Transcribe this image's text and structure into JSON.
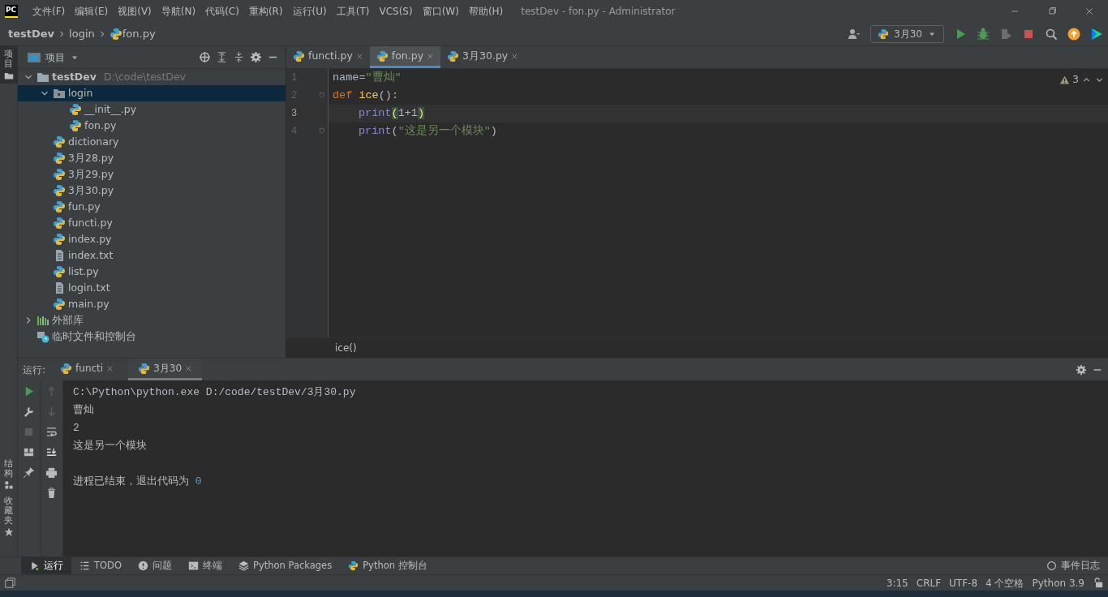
{
  "title_bar": {
    "logo": "PC",
    "menu": [
      "文件(F)",
      "编辑(E)",
      "视图(V)",
      "导航(N)",
      "代码(C)",
      "重构(R)",
      "运行(U)",
      "工具(T)",
      "VCS(S)",
      "窗口(W)",
      "帮助(H)"
    ],
    "title": "testDev - fon.py - Administrator"
  },
  "nav_bar": {
    "breadcrumb": [
      {
        "label": "testDev",
        "kind": "project"
      },
      {
        "label": "login",
        "kind": "folder"
      },
      {
        "label": "fon.py",
        "kind": "python"
      }
    ],
    "run_config": "3月30"
  },
  "side_strip": [
    {
      "label": "项目",
      "selected": true
    },
    {
      "label": "结构",
      "selected": false
    },
    {
      "label": "收藏夹",
      "selected": false
    }
  ],
  "project_panel": {
    "title": "项目",
    "tree": [
      {
        "label": "testDev",
        "hint": "D:\\code\\testDev",
        "kind": "project",
        "expanded": true,
        "selected": false,
        "children": [
          {
            "label": "login",
            "kind": "package",
            "expanded": true,
            "selected": true,
            "children": [
              {
                "label": "__init__.py",
                "kind": "python",
                "selected": false
              },
              {
                "label": "fon.py",
                "kind": "python",
                "selected": false
              }
            ]
          },
          {
            "label": " dictionary",
            "kind": "python",
            "selected": false
          },
          {
            "label": "3月28.py",
            "kind": "python",
            "selected": false
          },
          {
            "label": "3月29.py",
            "kind": "python",
            "selected": false
          },
          {
            "label": "3月30.py",
            "kind": "python",
            "selected": false
          },
          {
            "label": "fun.py",
            "kind": "python",
            "selected": false
          },
          {
            "label": "functi.py",
            "kind": "python",
            "selected": false
          },
          {
            "label": "index.py",
            "kind": "python",
            "selected": false
          },
          {
            "label": "index.txt",
            "kind": "text",
            "selected": false
          },
          {
            "label": "list.py",
            "kind": "python",
            "selected": false
          },
          {
            "label": "login.txt",
            "kind": "text",
            "selected": false
          },
          {
            "label": "main.py",
            "kind": "python",
            "selected": false
          }
        ]
      },
      {
        "label": "外部库",
        "kind": "library",
        "expanded": false,
        "selected": false
      },
      {
        "label": "临时文件和控制台",
        "kind": "scratch",
        "selected": false
      }
    ]
  },
  "editor": {
    "tabs": [
      {
        "label": "functi.py",
        "selected": false
      },
      {
        "label": "fon.py",
        "selected": true
      },
      {
        "label": "3月30.py",
        "selected": false
      }
    ],
    "warnings": "3",
    "lines": [
      {
        "number": "1",
        "current": false,
        "fold": false,
        "indented": false,
        "tokens": [
          {
            "text": "name",
            "kind": "plain"
          },
          {
            "text": "=",
            "kind": "plain"
          },
          {
            "text": "\"曹灿\"",
            "kind": "string"
          }
        ]
      },
      {
        "number": "2",
        "current": false,
        "fold": true,
        "indented": false,
        "tokens": [
          {
            "text": "def",
            "kind": "keyword"
          },
          {
            "text": "ice",
            "kind": "function"
          },
          {
            "text": "():",
            "kind": "plain"
          }
        ]
      },
      {
        "number": "3",
        "current": true,
        "fold": false,
        "indented": true,
        "tokens": [
          {
            "text": "print",
            "kind": "builtin"
          },
          {
            "text": "(",
            "kind": "match"
          },
          {
            "text": "1+1",
            "kind": "plain"
          },
          {
            "text": ")",
            "kind": "match"
          }
        ]
      },
      {
        "number": "4",
        "current": false,
        "fold": true,
        "indented": true,
        "tokens": [
          {
            "text": "print",
            "kind": "builtin"
          },
          {
            "text": "(",
            "kind": "plain"
          },
          {
            "text": "\"这是另一个模块\"",
            "kind": "string"
          },
          {
            "text": ")",
            "kind": "plain"
          }
        ]
      }
    ],
    "footer": "ice()"
  },
  "run_panel": {
    "label": "运行:",
    "tabs": [
      {
        "label": "functi",
        "selected": false
      },
      {
        "label": "3月30",
        "selected": true
      }
    ],
    "output": [
      {
        "kind": "command",
        "segments": [
          {
            "text": "C:\\Python\\python.exe D:/code/testDev/3月30.py",
            "kind": "plain"
          }
        ]
      },
      {
        "kind": "normal",
        "segments": [
          {
            "text": "曹灿",
            "kind": "plain"
          }
        ]
      },
      {
        "kind": "normal",
        "segments": [
          {
            "text": "2",
            "kind": "plain"
          }
        ]
      },
      {
        "kind": "normal",
        "segments": [
          {
            "text": "这是另一个模块",
            "kind": "plain"
          }
        ]
      },
      {
        "kind": "blank"
      },
      {
        "kind": "normal",
        "segments": [
          {
            "text": "进程已结束，退出代码为 ",
            "kind": "plain"
          },
          {
            "text": "0",
            "kind": "number"
          }
        ]
      }
    ]
  },
  "tool_tabs": [
    {
      "label": "运行",
      "kind": "run",
      "selected": true
    },
    {
      "label": "TODO",
      "kind": "todo",
      "selected": false
    },
    {
      "label": "问题",
      "kind": "problems",
      "selected": false
    },
    {
      "label": "终端",
      "kind": "terminal",
      "selected": false
    },
    {
      "label": "Python Packages",
      "kind": "packages",
      "selected": false
    },
    {
      "label": "Python 控制台",
      "kind": "console",
      "selected": false
    }
  ],
  "event_log": "事件日志",
  "status_bar": [
    "3:15",
    "CRLF",
    "UTF-8",
    "4 个空格",
    "Python 3.9"
  ]
}
